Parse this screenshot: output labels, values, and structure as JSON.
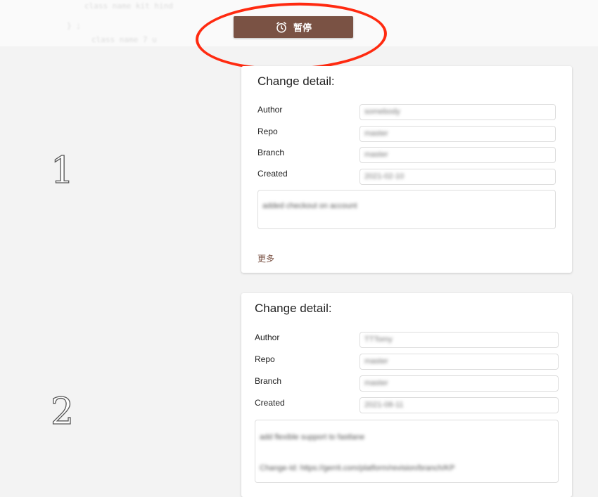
{
  "toolbar": {
    "pause_label": "暂停"
  },
  "annotations": {
    "step1": "1",
    "step2": "2",
    "oval_color": "#ff2a10",
    "arrow_color": "#ff2a10"
  },
  "cards": [
    {
      "title": "Change detail:",
      "fields": [
        {
          "label": "Author",
          "value": "somebody"
        },
        {
          "label": "Repo",
          "value": "master"
        },
        {
          "label": "Branch",
          "value": "master"
        },
        {
          "label": "Created",
          "value": "2021-02-10"
        }
      ],
      "message_lines": [
        "added checkout on account"
      ],
      "more_label": "更多"
    },
    {
      "title": "Change detail:",
      "fields": [
        {
          "label": "Author",
          "value": "TTTomy"
        },
        {
          "label": "Repo",
          "value": "master"
        },
        {
          "label": "Branch",
          "value": "master"
        },
        {
          "label": "Created",
          "value": "2021-08-11"
        }
      ],
      "message_lines": [
        "add flexible support to fastlane",
        "Change-Id: https://gerrit.com/platform/revision/branch/KP"
      ]
    }
  ],
  "colors": {
    "accent": "#7a5244",
    "background": "#f3f3f3"
  }
}
